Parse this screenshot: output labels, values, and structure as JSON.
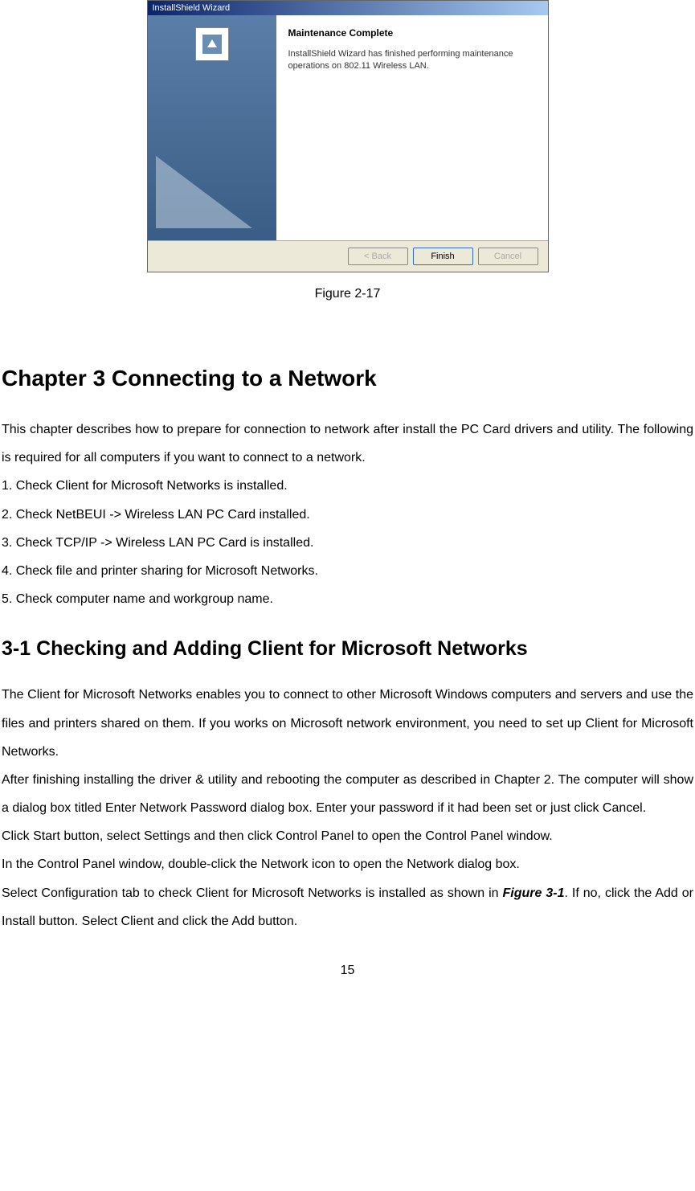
{
  "wizard": {
    "titlebar": "InstallShield Wizard",
    "heading": "Maintenance Complete",
    "body_text": "InstallShield Wizard has finished performing maintenance operations on 802.11 Wireless LAN.",
    "buttons": {
      "back": "< Back",
      "finish": "Finish",
      "cancel": "Cancel"
    }
  },
  "caption": "Figure 2-17",
  "chapter_title": "Chapter 3 Connecting to a Network",
  "intro_para": "This chapter describes how to prepare for connection to network after install the PC Card drivers and utility. The following is required for all computers if you want to connect to a network.",
  "steps": {
    "s1": "1. Check Client for Microsoft Networks is installed.",
    "s2": "2. Check NetBEUI -> Wireless LAN PC Card installed.",
    "s3": "3. Check TCP/IP -> Wireless LAN PC Card is installed.",
    "s4": "4. Check file and printer sharing for Microsoft Networks.",
    "s5": "5. Check computer name and workgroup name."
  },
  "section_title": "3-1 Checking and Adding Client for Microsoft Networks",
  "section_p1": "The Client for Microsoft Networks enables you to connect to other Microsoft Windows computers and servers and use the files and printers shared on them. If you works on Microsoft network environment, you need to set up Client for Microsoft Networks.",
  "section_p2": "After finishing installing the driver & utility and rebooting the computer as described in Chapter 2. The computer will show a dialog box titled Enter Network Password dialog box. Enter your password if it had been set or just click Cancel.",
  "section_p3": "Click Start button, select Settings and then click Control Panel to open the Control Panel window.",
  "section_p4": "In the Control Panel window, double-click the Network icon to open the Network dialog box.",
  "section_p5a": "Select Configuration tab to check Client for Microsoft Networks is installed as shown in ",
  "section_p5_ref": "Figure 3-1",
  "section_p5b": ". If no, click the Add or Install button. Select Client and click the Add button.",
  "page_number": "15"
}
